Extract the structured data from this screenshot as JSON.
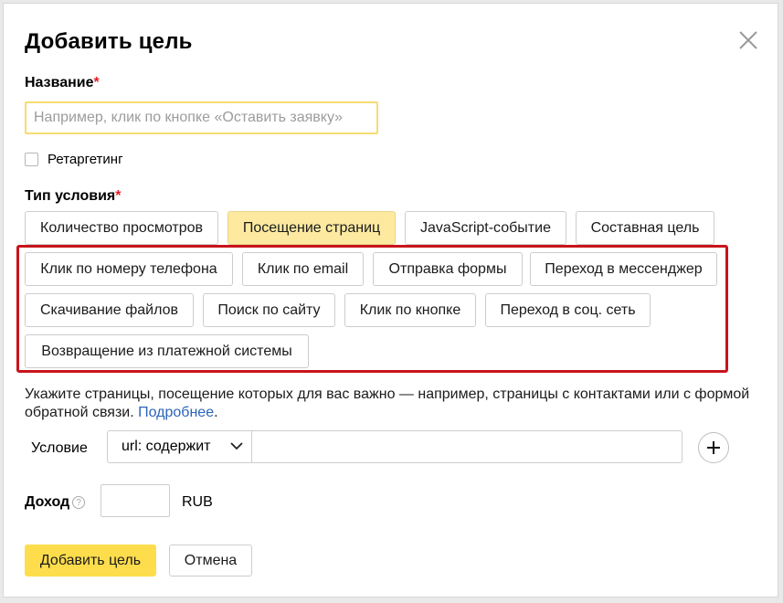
{
  "dialog": {
    "title": "Добавить цель",
    "name_label": "Название",
    "required_mark": "*",
    "name_placeholder": "Например, клик по кнопке «Оставить заявку»",
    "retargeting_label": "Ретаргетинг",
    "retargeting_checked": false,
    "condition_type_label": "Тип условия",
    "condition_types": [
      {
        "label": "Количество просмотров",
        "selected": false
      },
      {
        "label": "Посещение страниц",
        "selected": true
      },
      {
        "label": "JavaScript-событие",
        "selected": false
      },
      {
        "label": "Составная цель",
        "selected": false
      },
      {
        "label": "Клик по номеру телефона",
        "selected": false
      },
      {
        "label": "Клик по email",
        "selected": false
      },
      {
        "label": "Отправка формы",
        "selected": false
      },
      {
        "label": "Переход в мессенджер",
        "selected": false
      },
      {
        "label": "Скачивание файлов",
        "selected": false
      },
      {
        "label": "Поиск по сайту",
        "selected": false
      },
      {
        "label": "Клик по кнопке",
        "selected": false
      },
      {
        "label": "Переход в соц. сеть",
        "selected": false
      },
      {
        "label": "Возвращение из платежной системы",
        "selected": false
      }
    ],
    "hint_text": "Укажите страницы, посещение которых для вас важно — например, страницы с контактами или с формой обратной связи.",
    "hint_link": "Подробнее",
    "hint_end": ".",
    "condition_label": "Условие",
    "condition_select_value": "url: содержит",
    "condition_value": "",
    "income_label": "Доход",
    "income_help_glyph": "?",
    "income_value": "",
    "currency": "RUB",
    "add_button": "Добавить цель",
    "cancel_button": "Отмена"
  },
  "colors": {
    "accent_yellow": "#fedd4c",
    "selected_bg": "#fde9a0",
    "highlight_border": "#c8141b",
    "required": "#e0202a",
    "link": "#2b64b8"
  }
}
